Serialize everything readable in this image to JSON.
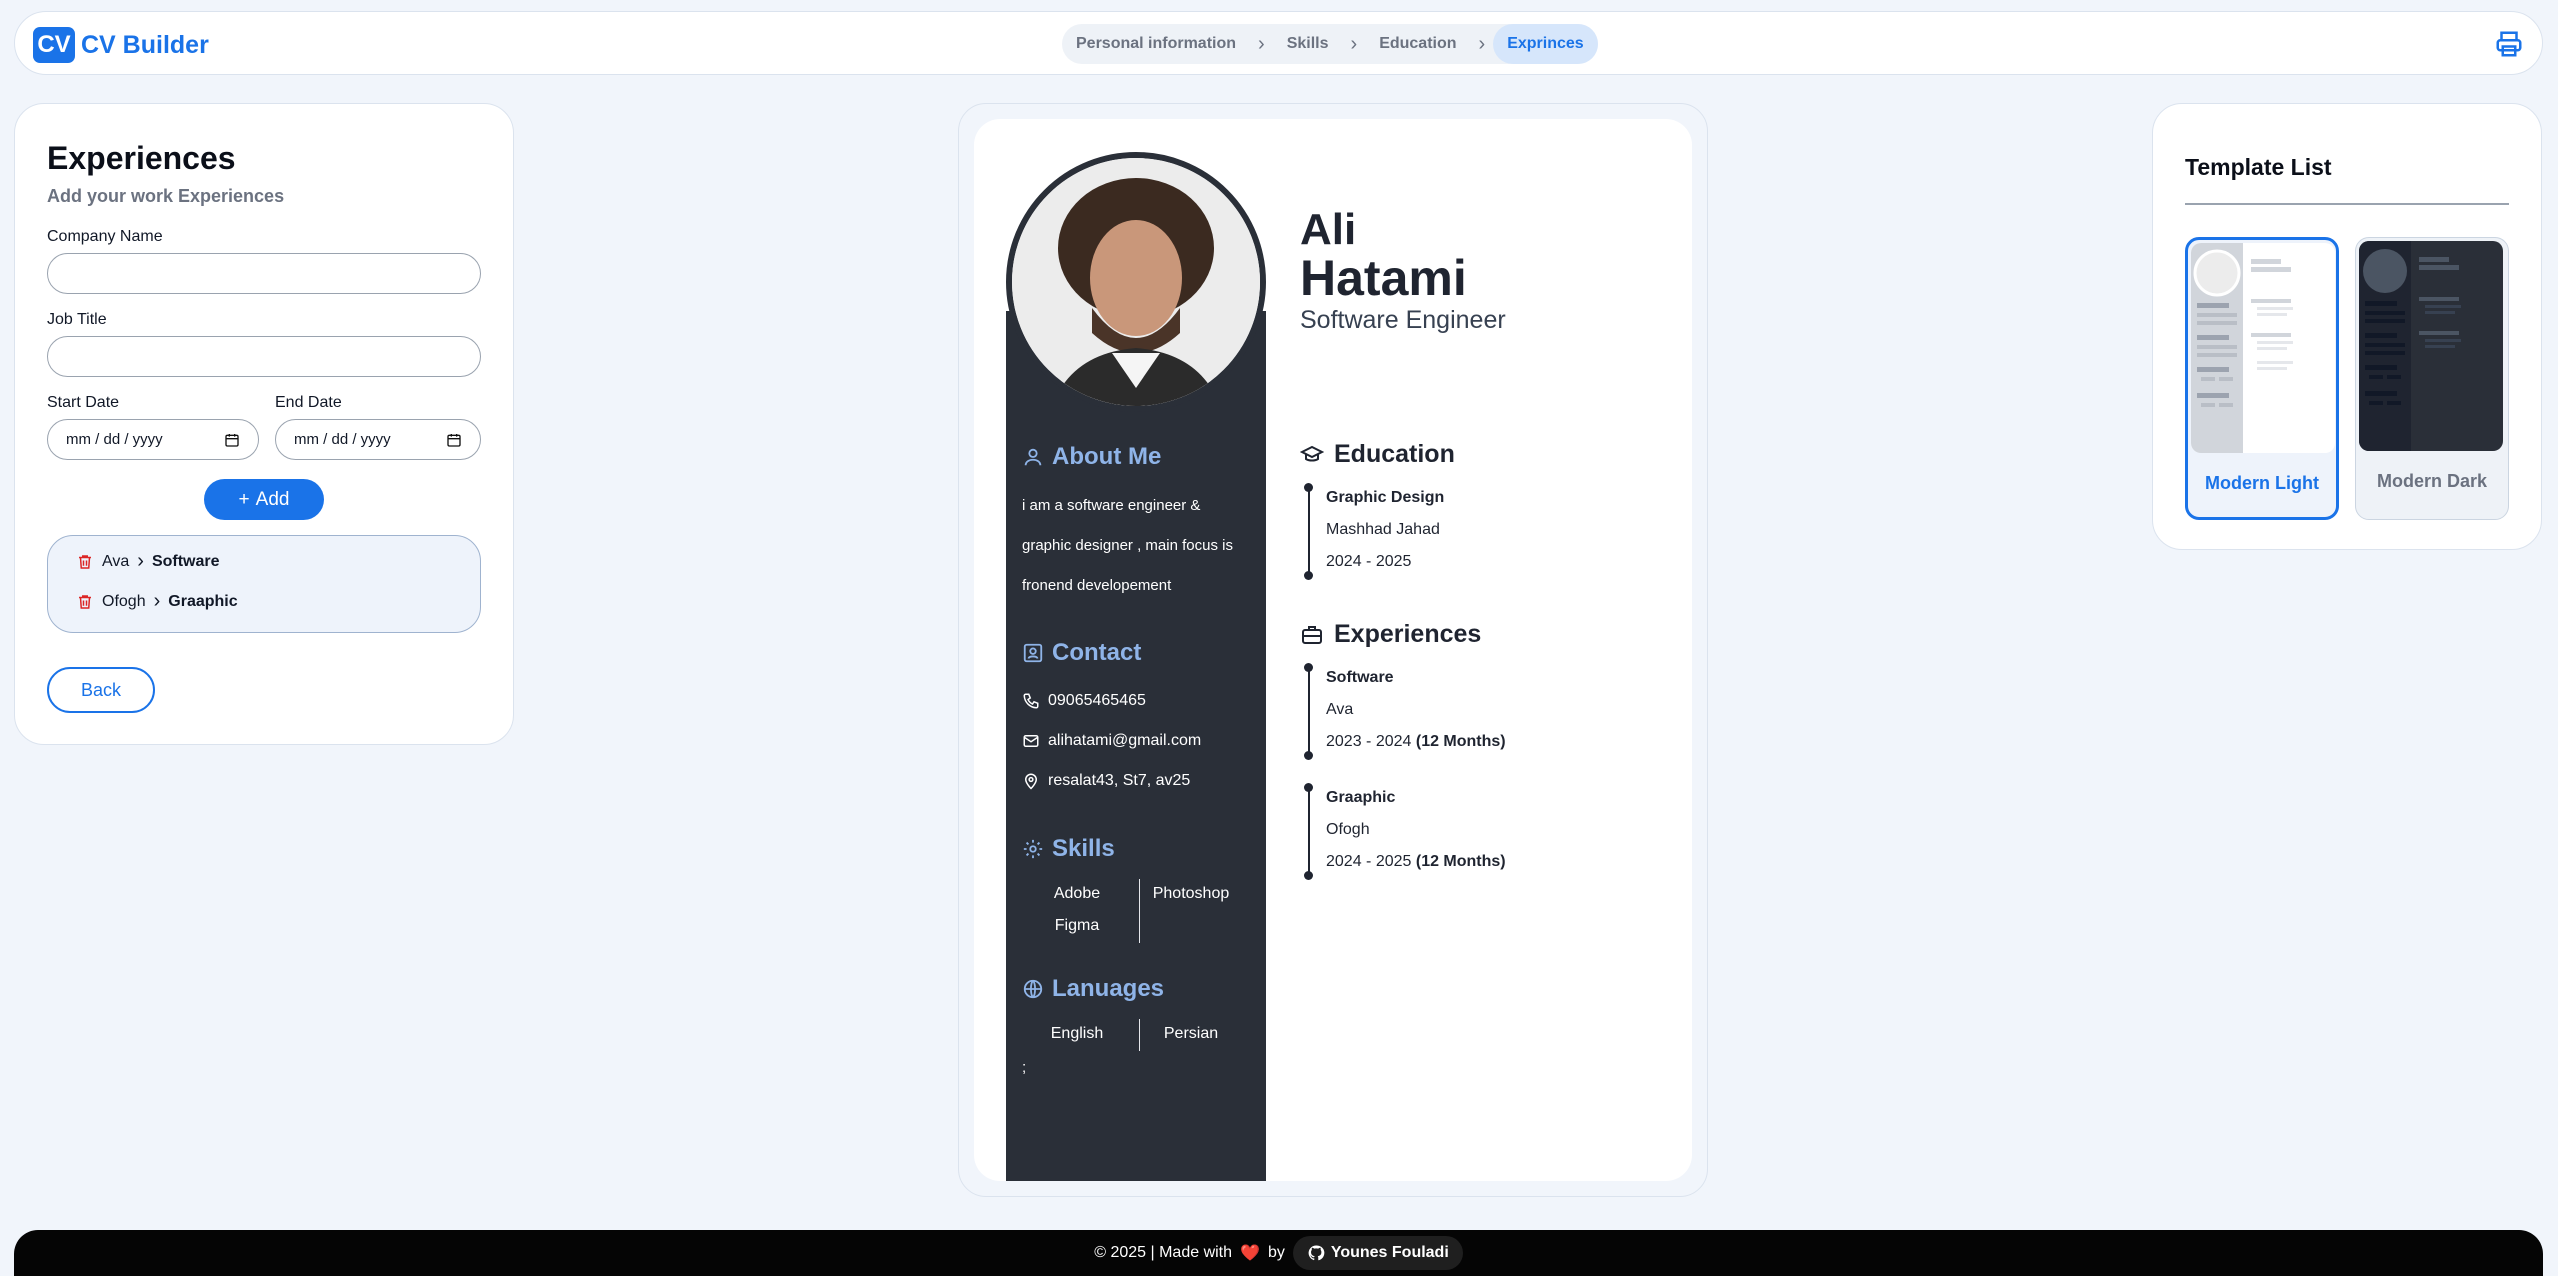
{
  "header": {
    "logo_initials": "CV",
    "app_title": "CV Builder",
    "steps": [
      "Personal information",
      "Skills",
      "Education",
      "Exprinces"
    ],
    "active_step_index": 3
  },
  "form": {
    "title": "Experiences",
    "subtitle": "Add your work Experiences",
    "company_label": "Company Name",
    "company_value": "",
    "job_label": "Job Title",
    "job_value": "",
    "start_label": "Start Date",
    "start_placeholder": "mm / dd / yyyy",
    "end_label": "End Date",
    "end_placeholder": "mm / dd / yyyy",
    "add_label": "Add",
    "back_label": "Back",
    "items": [
      {
        "company": "Ava",
        "job": "Software"
      },
      {
        "company": "Ofogh",
        "job": "Graaphic"
      }
    ]
  },
  "cv": {
    "first_name": "Ali",
    "last_name": "Hatami",
    "role": "Software Engineer",
    "about_title": "About Me",
    "about_lines": [
      "i am a software engineer &",
      "graphic designer , main focus is",
      "fronend developement"
    ],
    "contact_title": "Contact",
    "phone": "09065465465",
    "email": "alihatami@gmail.com",
    "address": "resalat43, St7, av25",
    "skills_title": "Skills",
    "skills": [
      "Adobe",
      "Photoshop",
      "Figma"
    ],
    "languages_title": "Lanuages",
    "languages": [
      "English",
      "Persian"
    ],
    "languages_extra": ";",
    "education_title": "Education",
    "education": {
      "degree": "Graphic Design",
      "school": "Mashhad Jahad",
      "years": "2024 - 2025"
    },
    "experiences_title": "Experiences",
    "experiences": [
      {
        "job": "Software",
        "company": "Ava",
        "years": "2023 - 2024",
        "duration": "(12 Months)"
      },
      {
        "job": "Graaphic",
        "company": "Ofogh",
        "years": "2024 - 2025",
        "duration": "(12 Months)"
      }
    ]
  },
  "templates": {
    "title": "Template List",
    "items": [
      {
        "name": "Modern Light",
        "selected": true
      },
      {
        "name": "Modern Dark",
        "selected": false
      }
    ]
  },
  "footer": {
    "text": "© 2025 | Made with",
    "heart": "❤️",
    "by": "by",
    "author": "Younes Fouladi"
  },
  "colors": {
    "accent": "#1a73e8",
    "sidebar": "#2a2f38",
    "side_heading": "#8fb4e8",
    "delete": "#dc2626"
  }
}
